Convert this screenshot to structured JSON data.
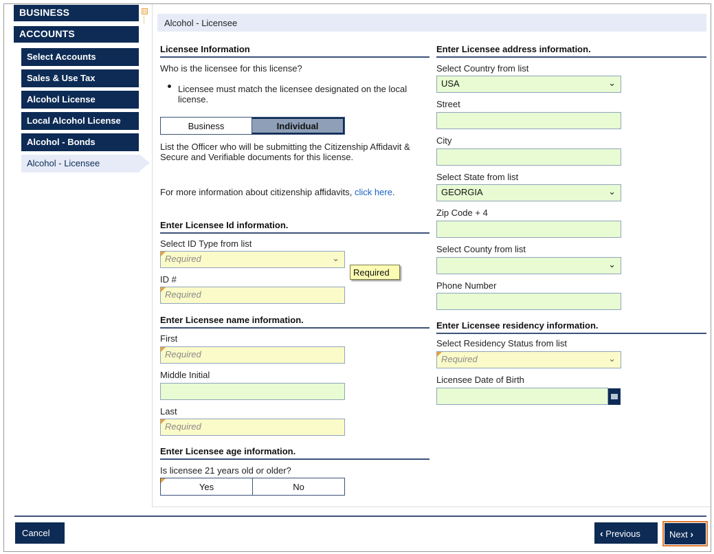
{
  "sidebar": {
    "headers": [
      "BUSINESS",
      "ACCOUNTS"
    ],
    "items": [
      {
        "label": "Select Accounts"
      },
      {
        "label": "Sales & Use Tax"
      },
      {
        "label": "Alcohol License"
      },
      {
        "label": "Local Alcohol License"
      },
      {
        "label": "Alcohol - Bonds"
      },
      {
        "label": "Alcohol - Licensee"
      }
    ]
  },
  "page": {
    "title": "Alcohol - Licensee"
  },
  "licensee_info": {
    "heading": "Licensee Information",
    "question": "Who is the licensee for this license?",
    "bullet": "Licensee must match the licensee designated on the local license.",
    "options": [
      "Business",
      "Individual"
    ],
    "selected": "Individual",
    "officer_note": "List the Officer who will be submitting the Citizenship Affidavit & Secure and Verifiable documents for this license.",
    "more_info_prefix": "For more information about citizenship affidavits, ",
    "more_info_link": "click here",
    "more_info_suffix": "."
  },
  "id_info": {
    "heading": "Enter Licensee Id information.",
    "id_type_label": "Select ID Type from list",
    "id_type_placeholder": "Required",
    "id_number_label": "ID #",
    "id_number_placeholder": "Required",
    "tooltip": "Required"
  },
  "name_info": {
    "heading": "Enter Licensee name information.",
    "first_label": "First",
    "first_placeholder": "Required",
    "middle_label": "Middle Initial",
    "last_label": "Last",
    "last_placeholder": "Required"
  },
  "age_info": {
    "heading": "Enter Licensee age information.",
    "question": "Is licensee 21 years old or older?",
    "options": [
      "Yes",
      "No"
    ]
  },
  "address_info": {
    "heading": "Enter Licensee address information.",
    "country_label": "Select Country from list",
    "country_value": "USA",
    "street_label": "Street",
    "city_label": "City",
    "state_label": "Select State from list",
    "state_value": "GEORGIA",
    "zip_label": "Zip Code + 4",
    "county_label": "Select County from list",
    "phone_label": "Phone Number"
  },
  "residency_info": {
    "heading": "Enter Licensee residency information.",
    "status_label": "Select Residency Status from list",
    "status_placeholder": "Required",
    "dob_label": "Licensee Date of Birth"
  },
  "footer": {
    "cancel": "Cancel",
    "previous": "Previous",
    "next": "Next"
  },
  "icons": {
    "chevron": "chevron-down-icon",
    "calendar": "calendar-icon",
    "collapse": "collapse-icon"
  },
  "colors": {
    "navy": "#0d2b55",
    "field_green": "#e8fbd2",
    "field_required": "#fbfbc9",
    "accent_orange": "#e07a2f"
  }
}
